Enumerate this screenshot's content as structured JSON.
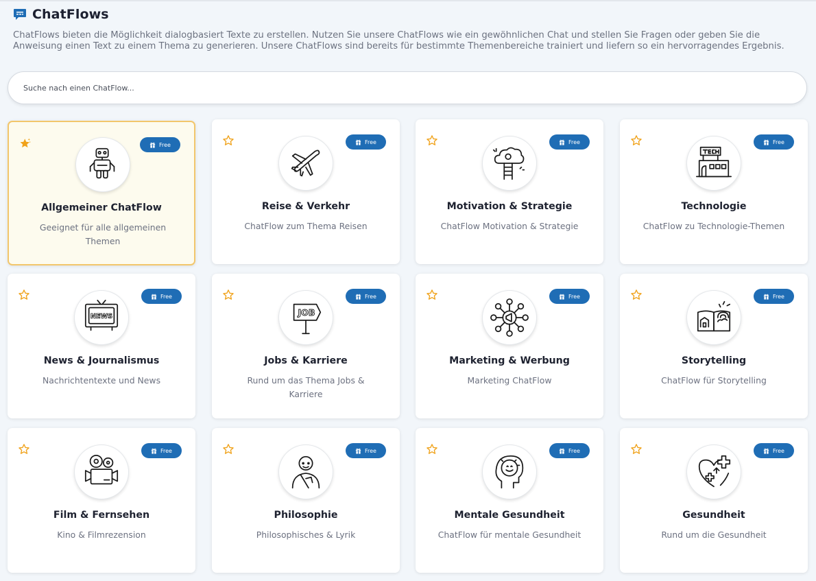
{
  "header": {
    "title": "ChatFlows",
    "description": "ChatFlows bieten die Möglichkeit dialogbasiert Texte zu erstellen. Nutzen Sie unsere ChatFlows wie ein gewöhnlichen Chat und stellen Sie Fragen oder geben Sie die Anweisung einen Text zu einem Thema zu generieren. Unsere ChatFlows sind bereits für bestimmte Themenbereiche trainiert und liefern so ein hervorragendes Ergebnis."
  },
  "search": {
    "placeholder": "Suche nach einen ChatFlow...",
    "value": ""
  },
  "colors": {
    "accent": "#1f6db5",
    "star": "#f0a21a",
    "active_border": "#f2c66b",
    "active_bg": "#fdfbee"
  },
  "cards": [
    {
      "title": "Allgemeiner ChatFlow",
      "description": "Geeignet für alle allgemeinen Themen",
      "badge": "Free",
      "icon": "robot-icon",
      "favorite": true
    },
    {
      "title": "Reise & Verkehr",
      "description": "ChatFlow zum Thema Reisen",
      "badge": "Free",
      "icon": "airplane-icon",
      "favorite": false
    },
    {
      "title": "Motivation & Strategie",
      "description": "ChatFlow Motivation & Strategie",
      "badge": "Free",
      "icon": "cloud-ladder-icon",
      "favorite": false
    },
    {
      "title": "Technologie",
      "description": "ChatFlow zu Technologie-Themen",
      "badge": "Free",
      "icon": "tech-building-icon",
      "favorite": false
    },
    {
      "title": "News & Journalismus",
      "description": "Nachrichtentexte und News",
      "badge": "Free",
      "icon": "news-tv-icon",
      "favorite": false
    },
    {
      "title": "Jobs & Karriere",
      "description": "Rund um das Thema Jobs & Karriere",
      "badge": "Free",
      "icon": "job-sign-icon",
      "favorite": false
    },
    {
      "title": "Marketing & Werbung",
      "description": "Marketing ChatFlow",
      "badge": "Free",
      "icon": "megaphone-network-icon",
      "favorite": false
    },
    {
      "title": "Storytelling",
      "description": "ChatFlow für Storytelling",
      "badge": "Free",
      "icon": "storybook-icon",
      "favorite": false
    },
    {
      "title": "Film & Fernsehen",
      "description": "Kino & Filmrezension",
      "badge": "Free",
      "icon": "film-camera-icon",
      "favorite": false
    },
    {
      "title": "Philosophie",
      "description": "Philosophisches & Lyrik",
      "badge": "Free",
      "icon": "monk-icon",
      "favorite": false
    },
    {
      "title": "Mentale Gesundheit",
      "description": "ChatFlow für mentale Gesundheit",
      "badge": "Free",
      "icon": "mind-head-icon",
      "favorite": false
    },
    {
      "title": "Gesundheit",
      "description": "Rund um die Gesundheit",
      "badge": "Free",
      "icon": "heart-health-icon",
      "favorite": false
    }
  ]
}
